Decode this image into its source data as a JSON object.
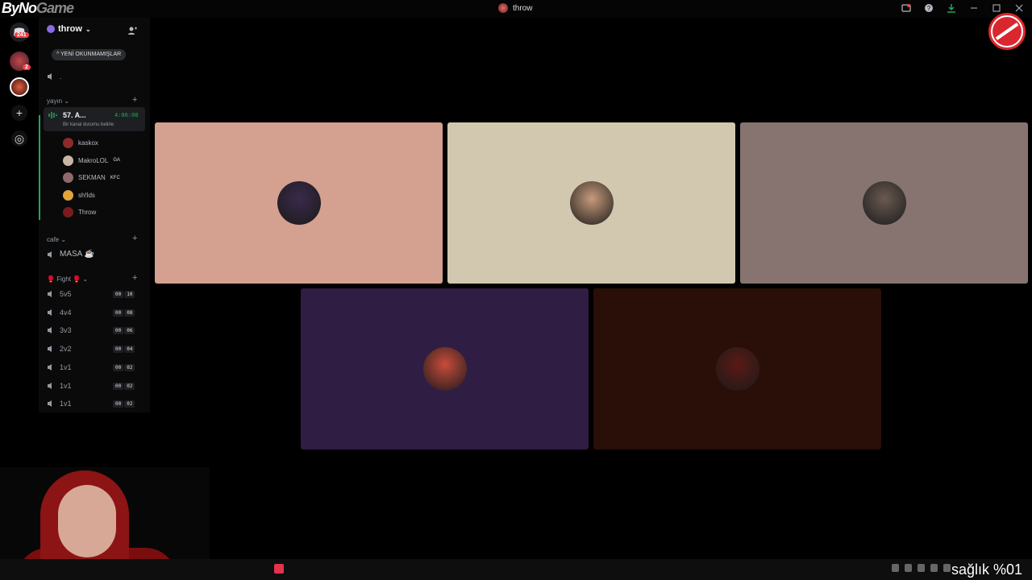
{
  "window": {
    "title": "throw"
  },
  "watermark": {
    "part1": "ByNo",
    "part2": "Game"
  },
  "rail": {
    "home_badge": "241",
    "server2_badge": "2"
  },
  "server": {
    "name": "throw"
  },
  "unread_pill": "YENİ OKUNMAMIŞLAR",
  "channel_dot": ".",
  "categories": {
    "yayin": "yayın",
    "cafe": "cafe",
    "fight": "Fight"
  },
  "live_channel": {
    "name": "57. A...",
    "time": "4:06:08",
    "status": "Bir kanal durumu belirle"
  },
  "voice_users": [
    {
      "name": "kaskox",
      "tag": "",
      "color": "#8a2b2b"
    },
    {
      "name": "MakroLOL",
      "tag": "GA",
      "color": "#c9b7a5"
    },
    {
      "name": "SEKMAN",
      "tag": "KFC",
      "color": "#8f6a6a"
    },
    {
      "name": "sh!lds",
      "tag": "",
      "color": "#e0a63c"
    },
    {
      "name": "Throw",
      "tag": "",
      "color": "#7a1c1c"
    }
  ],
  "cafe_channel": "MASA ☕",
  "fight_channels": [
    {
      "name": "5v5",
      "a": "00",
      "b": "10"
    },
    {
      "name": "4v4",
      "a": "00",
      "b": "08"
    },
    {
      "name": "3v3",
      "a": "00",
      "b": "06"
    },
    {
      "name": "2v2",
      "a": "00",
      "b": "04"
    },
    {
      "name": "1v1",
      "a": "00",
      "b": "02"
    },
    {
      "name": "1v1",
      "a": "00",
      "b": "02"
    },
    {
      "name": "1v1",
      "a": "00",
      "b": "02"
    }
  ],
  "tiles": [
    {
      "bg": "#d4a090",
      "avatar": "#3a2a4a"
    },
    {
      "bg": "#d2c8b0",
      "avatar": "#c79b7c"
    },
    {
      "bg": "#877470",
      "avatar": "#6b5a52"
    },
    {
      "bg": "#2f1d44",
      "avatar": "#c94b3b"
    },
    {
      "bg": "#2a0e08",
      "avatar": "#5a1a14"
    }
  ],
  "overlay": {
    "health": "sağlık %01"
  },
  "colors": {
    "online": "#23a55a",
    "badge": "#f23f43",
    "accent": "#d9272e"
  }
}
